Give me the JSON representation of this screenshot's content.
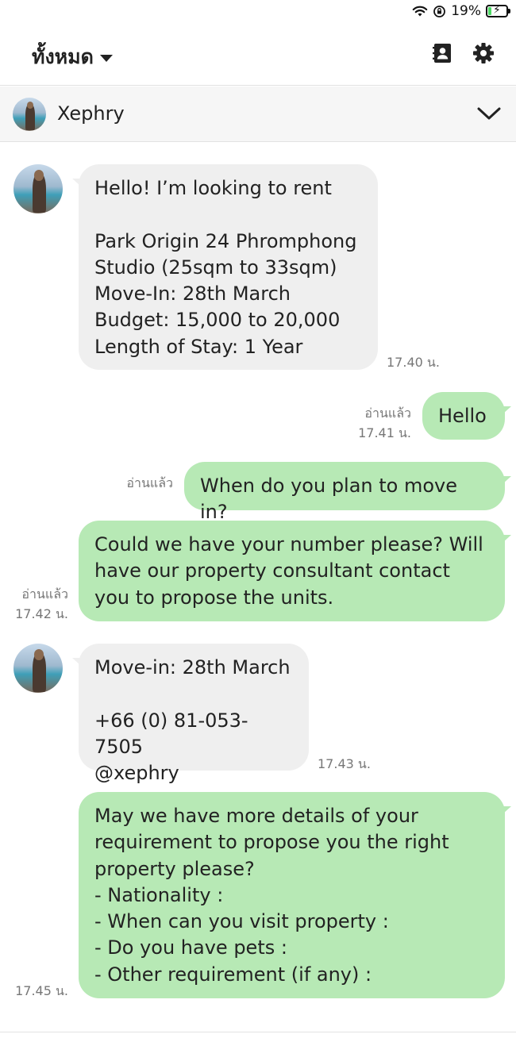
{
  "status_bar": {
    "battery_percent": "19%",
    "battery_level": 0.19
  },
  "header": {
    "title": "ทั้งหมด"
  },
  "chat": {
    "contact_name": "Xephry"
  },
  "messages": [
    {
      "direction": "incoming",
      "text": "Hello! I’m looking to rent\n\nPark Origin 24 Phromphong\nStudio (25sqm to 33sqm)\nMove-In: 28th March\nBudget: 15,000 to 20,000\nLength of Stay: 1 Year",
      "time": "17.40 น."
    },
    {
      "direction": "outgoing",
      "text": "Hello",
      "read": "อ่านแล้ว",
      "time": "17.41 น."
    },
    {
      "direction": "outgoing",
      "text": "When do you plan to move in?",
      "read": "อ่านแล้ว",
      "time": ""
    },
    {
      "direction": "outgoing",
      "text": "Could we have your number please? Will\nhave our property consultant contact\nyou to propose the units.",
      "read": "อ่านแล้ว",
      "time": "17.42 น."
    },
    {
      "direction": "incoming",
      "text": "Move-in: 28th March\n\n+66 (0) 81-053-7505\n@xephry",
      "time": "17.43 น."
    },
    {
      "direction": "outgoing",
      "text": "May we have more details of your\nrequirement to propose you the right\nproperty please?\n- Nationality :\n- When can you visit property :\n- Do you have pets :\n- Other requirement (if any) :",
      "time": "17.45 น."
    }
  ],
  "icons": {
    "wifi": "wifi-icon",
    "rotation_lock": "rotation-lock-icon",
    "battery": "battery-icon",
    "contacts": "contact-book-icon",
    "settings": "gear-icon",
    "collapse": "chevron-down-icon"
  },
  "colors": {
    "incoming_bubble": "#efefef",
    "outgoing_bubble": "#b7e9b5",
    "battery_fill": "#4cd964"
  }
}
